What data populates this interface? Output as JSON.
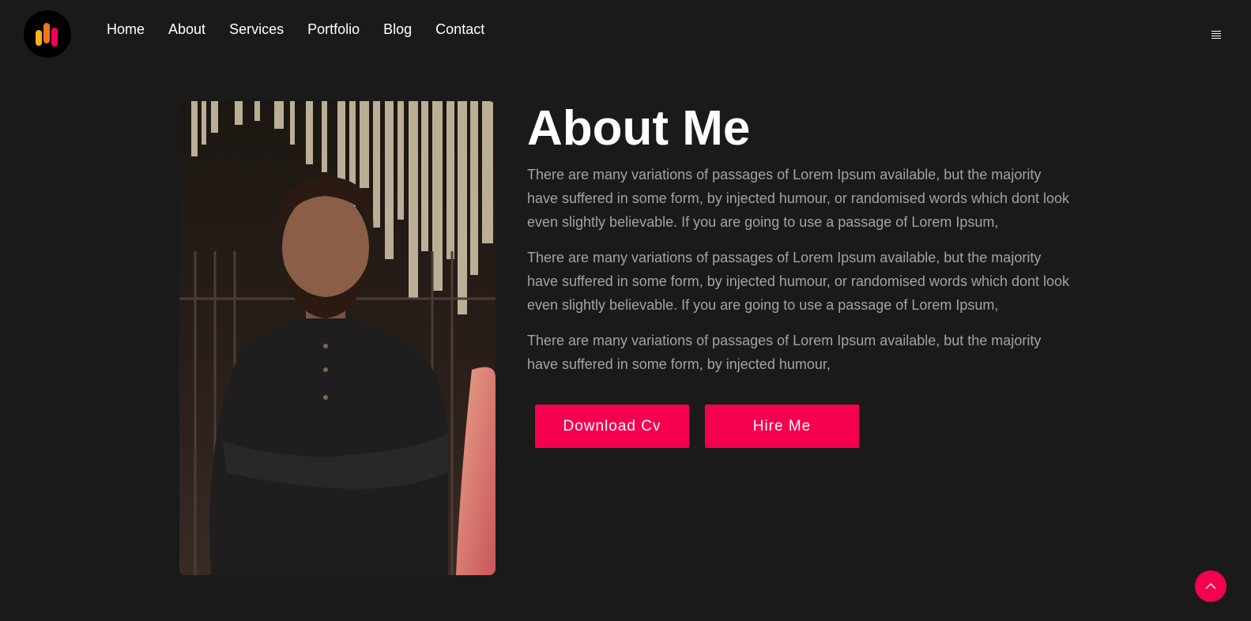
{
  "header": {
    "nav": [
      "Home",
      "About",
      "Services",
      "Portfolio",
      "Blog",
      "Contact"
    ],
    "logo_icon": "bars-logo-icon",
    "menu_icon": "hamburger-icon"
  },
  "about": {
    "title": "About Me",
    "paragraphs": [
      "There are many variations of passages of Lorem Ipsum available, but the majority have suffered in some form, by injected humour, or randomised words which dont look even slightly believable. If you are going to use a passage of Lorem Ipsum,",
      "There are many variations of passages of Lorem Ipsum available, but the majority have suffered in some form, by injected humour, or randomised words which dont look even slightly believable. If you are going to use a passage of Lorem Ipsum,",
      "There are many variations of passages of Lorem Ipsum available, but the majority have suffered in some form, by injected humour,"
    ],
    "buttons": {
      "download_cv": "Download Cv",
      "hire_me": "Hire Me"
    }
  },
  "colors": {
    "background": "#1a1a1b",
    "accent": "#f5004f",
    "text": "#ffffff",
    "muted_text": "#a3a3a3"
  },
  "scroll_top_icon": "chevron-up-icon"
}
